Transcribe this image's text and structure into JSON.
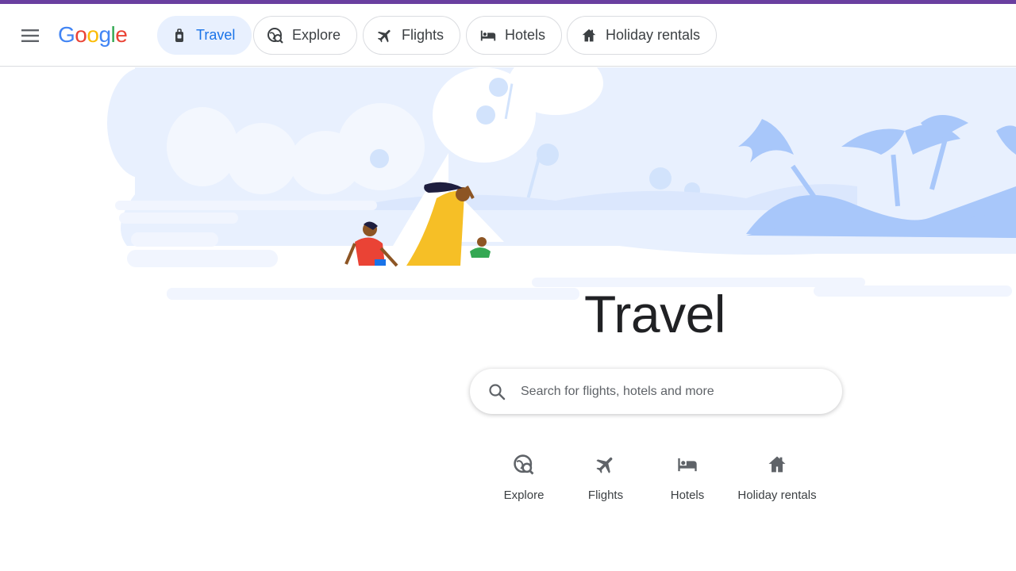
{
  "header": {
    "logo_letters": [
      {
        "char": "G",
        "color": "#4285F4"
      },
      {
        "char": "o",
        "color": "#EA4335"
      },
      {
        "char": "o",
        "color": "#FBBC05"
      },
      {
        "char": "g",
        "color": "#4285F4"
      },
      {
        "char": "l",
        "color": "#34A853"
      },
      {
        "char": "e",
        "color": "#EA4335"
      }
    ],
    "tabs": [
      {
        "label": "Travel",
        "icon": "luggage-icon",
        "active": true
      },
      {
        "label": "Explore",
        "icon": "explore-icon",
        "active": false
      },
      {
        "label": "Flights",
        "icon": "flight-icon",
        "active": false
      },
      {
        "label": "Hotels",
        "icon": "hotel-bed-icon",
        "active": false
      },
      {
        "label": "Holiday rentals",
        "icon": "house-icon",
        "active": false
      }
    ]
  },
  "main": {
    "title": "Travel",
    "search": {
      "placeholder": "Search for flights, hotels and more",
      "value": ""
    },
    "quick_links": [
      {
        "label": "Explore",
        "icon": "explore-icon"
      },
      {
        "label": "Flights",
        "icon": "flight-icon"
      },
      {
        "label": "Hotels",
        "icon": "hotel-bed-icon"
      },
      {
        "label": "Holiday rentals",
        "icon": "house-icon"
      }
    ]
  },
  "colors": {
    "accent": "#1a73e8",
    "active_tab_bg": "#e8f0fe",
    "top_stripe": "#6a3fa0",
    "hero_sky": "#e8f0fe",
    "hero_palm": "#a8c7fa"
  }
}
